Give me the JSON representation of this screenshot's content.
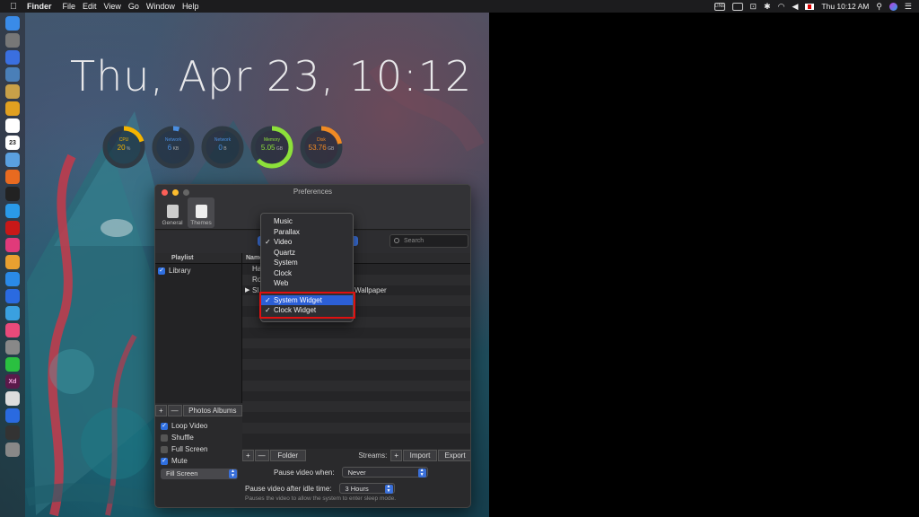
{
  "menubar": {
    "apple": "",
    "app": "Finder",
    "items": [
      "File",
      "Edit",
      "View",
      "Go",
      "Window",
      "Help"
    ],
    "clock": "Thu 10:12 AM",
    "tray_line": "LINE"
  },
  "desktop": {
    "date_time": "Thu, Apr 23, 10:12",
    "gauges": [
      {
        "label": "CPU",
        "value": "20",
        "unit": "%",
        "color": "#f5b400",
        "percent": 20
      },
      {
        "label": "Network",
        "value": "6",
        "unit": "KB",
        "color": "#4a8ee0",
        "percent": 5
      },
      {
        "label": "Network",
        "value": "0",
        "unit": "B",
        "color": "#4a8ee0",
        "percent": 0
      },
      {
        "label": "Memory",
        "value": "5.05",
        "unit": "GB",
        "color": "#8de03a",
        "percent": 63
      },
      {
        "label": "Disk",
        "value": "53.76",
        "unit": "GB",
        "color": "#f08a24",
        "percent": 22
      }
    ]
  },
  "dock_icons": [
    "finder-icon",
    "launchpad-icon",
    "safari-icon",
    "mail-icon",
    "folder-icon",
    "chrome-icon",
    "notes-icon",
    "calendar-icon",
    "preview-icon",
    "firefox-icon",
    "terminal-icon",
    "messages-icon",
    "acrobat-icon",
    "slack-icon",
    "photos-icon",
    "appstore-icon",
    "xcode-icon",
    "maps-icon",
    "itunes-icon",
    "settings-icon",
    "line-icon",
    "xd-icon",
    "mail2-icon",
    "safari2-icon",
    "screen-icon",
    "trash-icon"
  ],
  "window": {
    "title": "Preferences",
    "tabs": [
      {
        "label": "General"
      },
      {
        "label": "Themes"
      }
    ],
    "search_placeholder": "Search",
    "sidebar_header": "Playlist",
    "sidebar_items": [
      {
        "label": "Library",
        "checked": true
      }
    ],
    "list_header": "Name",
    "list_rows": [
      "Ha",
      "Ro",
      "Sl",
      "",
      "",
      "",
      "",
      "",
      "",
      "",
      "",
      "",
      "",
      "",
      "",
      ""
    ],
    "list_row_suffix": "Wallpaper",
    "sidebar_toolbar": {
      "add": "+",
      "remove": "—",
      "photos": "Photos Albums"
    },
    "options": [
      {
        "label": "Loop Video",
        "checked": true
      },
      {
        "label": "Shuffle",
        "checked": false
      },
      {
        "label": "Full Screen",
        "checked": false
      },
      {
        "label": "Mute",
        "checked": true
      }
    ],
    "scale_mode": "Fill Screen",
    "list_toolbar": {
      "add": "+",
      "remove": "—",
      "folder": "Folder",
      "streams": "Streams:",
      "add2": "+",
      "import": "Import",
      "export": "Export"
    },
    "pause_when_label": "Pause video when:",
    "pause_when_value": "Never",
    "pause_idle_label": "Pause video after idle time:",
    "pause_idle_value": "3 Hours",
    "hint": "Pauses the video to allow the system to enter sleep mode."
  },
  "dropdown": {
    "items": [
      {
        "label": "Music",
        "checked": false
      },
      {
        "label": "Parallax",
        "checked": false
      },
      {
        "label": "Video",
        "checked": true
      },
      {
        "label": "Quartz",
        "checked": false
      },
      {
        "label": "System",
        "checked": false
      },
      {
        "label": "Clock",
        "checked": false
      },
      {
        "label": "Web",
        "checked": false
      }
    ],
    "widgets": [
      {
        "label": "System Widget",
        "checked": true,
        "highlighted": true
      },
      {
        "label": "Clock Widget",
        "checked": true,
        "highlighted": false
      }
    ],
    "check_glyph": "✓"
  },
  "colors": {
    "accent": "#2f6fe0",
    "highlight": "#e01010"
  }
}
